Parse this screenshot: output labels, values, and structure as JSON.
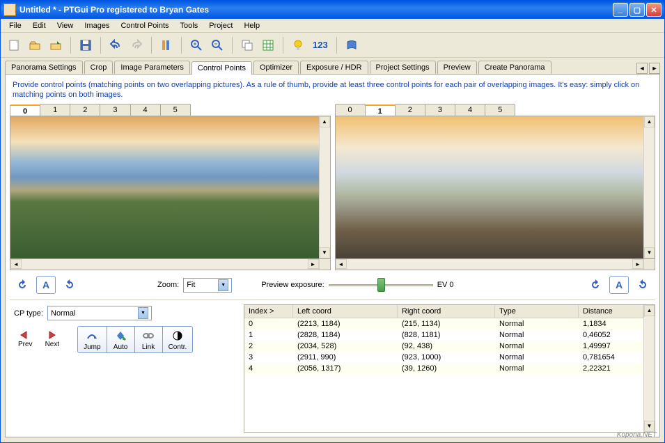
{
  "window": {
    "title": "Untitled * - PTGui Pro registered to Bryan Gates"
  },
  "menu": [
    "File",
    "Edit",
    "View",
    "Images",
    "Control Points",
    "Tools",
    "Project",
    "Help"
  ],
  "toolbar": {
    "num_label": "123",
    "icons": [
      "new-project",
      "open-project",
      "save-project",
      "undo",
      "redo",
      "align-tools",
      "zoom-in",
      "zoom-out",
      "copy",
      "spreadsheet",
      "idea",
      "numbers",
      "help-book"
    ]
  },
  "tabs": [
    "Panorama Settings",
    "Crop",
    "Image Parameters",
    "Control Points",
    "Optimizer",
    "Exposure / HDR",
    "Project Settings",
    "Preview",
    "Create Panorama"
  ],
  "active_tab": "Control Points",
  "instructions": "Provide control points (matching points on two overlapping pictures). As a rule of thumb, provide at least three control points for each pair of overlapping images. It's easy: simply click on matching points on both images.",
  "left_pane": {
    "tabs": [
      "0",
      "1",
      "2",
      "3",
      "4",
      "5"
    ],
    "active": "0"
  },
  "right_pane": {
    "tabs": [
      "0",
      "1",
      "2",
      "3",
      "4",
      "5"
    ],
    "active": "1"
  },
  "zoom": {
    "label": "Zoom:",
    "value": "Fit"
  },
  "preview_exposure": {
    "label": "Preview exposure:",
    "value": "EV 0"
  },
  "cp_type": {
    "label": "CP type:",
    "value": "Normal"
  },
  "nav": {
    "prev": "Prev",
    "next": "Next"
  },
  "buttons": {
    "jump": "Jump",
    "auto": "Auto",
    "link": "Link",
    "contr": "Contr."
  },
  "table": {
    "headers": [
      "Index >",
      "Left coord",
      "Right coord",
      "Type",
      "Distance"
    ],
    "rows": [
      {
        "idx": "0",
        "l": "(2213, 1184)",
        "r": "(215, 1134)",
        "t": "Normal",
        "d": "1,1834"
      },
      {
        "idx": "1",
        "l": "(2828, 1184)",
        "r": "(828, 1181)",
        "t": "Normal",
        "d": "0,46052"
      },
      {
        "idx": "2",
        "l": "(2034, 528)",
        "r": "(92, 438)",
        "t": "Normal",
        "d": "1,49997"
      },
      {
        "idx": "3",
        "l": "(2911, 990)",
        "r": "(923, 1000)",
        "t": "Normal",
        "d": "0,781654"
      },
      {
        "idx": "4",
        "l": "(2056, 1317)",
        "r": "(39, 1260)",
        "t": "Normal",
        "d": "2,22321"
      }
    ]
  },
  "watermark": "Kopona.NET"
}
